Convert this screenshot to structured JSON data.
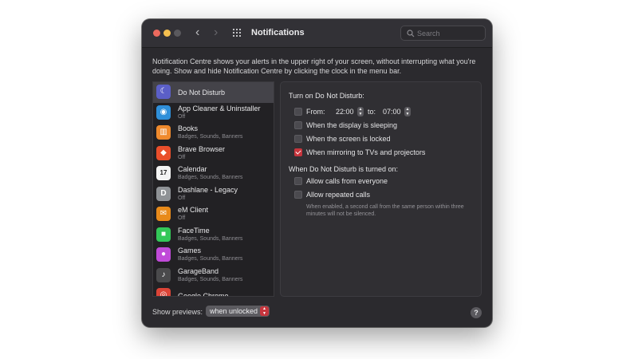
{
  "window": {
    "title": "Notifications",
    "search_placeholder": "Search"
  },
  "description": "Notification Centre shows your alerts in the upper right of your screen, without interrupting what you're doing. Show and hide Notification Centre by clicking the clock in the menu bar.",
  "apps": [
    {
      "name": "Do Not Disturb",
      "sub": "",
      "icon": "moon-icon",
      "color": "#5b5fc7",
      "glyph": "☾",
      "selected": true
    },
    {
      "name": "App Cleaner & Uninstaller",
      "sub": "Off",
      "icon": "app-cleaner-icon",
      "color": "#2f8fd9",
      "glyph": "◉"
    },
    {
      "name": "Books",
      "sub": "Badges, Sounds, Banners",
      "icon": "book-icon",
      "color": "#ef8a2d",
      "glyph": "▥"
    },
    {
      "name": "Brave Browser",
      "sub": "Off",
      "icon": "brave-lion-icon",
      "color": "#e94e2b",
      "glyph": "◆"
    },
    {
      "name": "Calendar",
      "sub": "Badges, Sounds, Banners",
      "icon": "calendar-icon",
      "color": "#f4f4f4",
      "glyph": "17"
    },
    {
      "name": "Dashlane - Legacy",
      "sub": "Off",
      "icon": "dashlane-icon",
      "color": "#8f9296",
      "glyph": "D"
    },
    {
      "name": "eM Client",
      "sub": "Off",
      "icon": "envelope-icon",
      "color": "#e88a1a",
      "glyph": "✉"
    },
    {
      "name": "FaceTime",
      "sub": "Badges, Sounds, Banners",
      "icon": "video-camera-icon",
      "color": "#33c758",
      "glyph": "■"
    },
    {
      "name": "Games",
      "sub": "Badges, Sounds, Banners",
      "icon": "games-icon",
      "color": "#c04ad8",
      "glyph": "●"
    },
    {
      "name": "GarageBand",
      "sub": "Badges, Sounds, Banners",
      "icon": "guitar-icon",
      "color": "#4a4a4c",
      "glyph": "♪"
    },
    {
      "name": "Google Chrome",
      "sub": "",
      "icon": "chrome-icon",
      "color": "#db4437",
      "glyph": "◎"
    }
  ],
  "dnd": {
    "turn_on_heading": "Turn on Do Not Disturb:",
    "from_label": "From:",
    "from_time": "22:00",
    "to_label": "to:",
    "to_time": "07:00",
    "options": [
      {
        "label": "When the display is sleeping",
        "checked": false
      },
      {
        "label": "When the screen is locked",
        "checked": false
      },
      {
        "label": "When mirroring to TVs and projectors",
        "checked": true
      }
    ],
    "when_on_heading": "When Do Not Disturb is turned on:",
    "call_options": [
      {
        "label": "Allow calls from everyone",
        "checked": false
      },
      {
        "label": "Allow repeated calls",
        "checked": false
      }
    ],
    "note": "When enabled, a second call from the same person within three minutes will not be silenced."
  },
  "footer": {
    "previews_label": "Show previews:",
    "previews_value": "when unlocked",
    "help": "?"
  },
  "colors": {
    "accent": "#c7353d",
    "window_bg": "#2b2a2e",
    "selection": "#444349"
  }
}
